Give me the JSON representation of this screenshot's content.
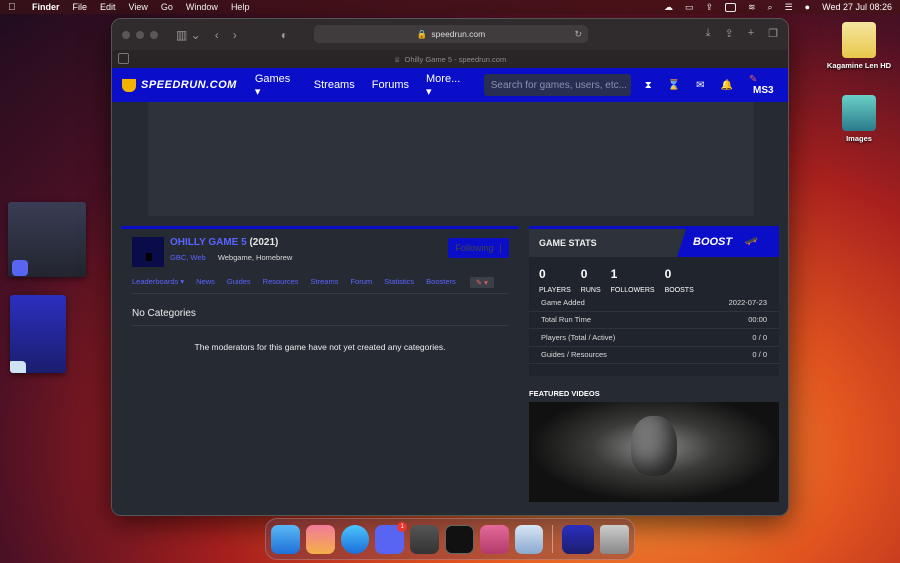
{
  "menubar": {
    "app_name": "Finder",
    "items": [
      "File",
      "Edit",
      "View",
      "Go",
      "Window",
      "Help"
    ],
    "datetime": "Wed 27 Jul  08:26"
  },
  "desktop": {
    "icons": [
      {
        "label": "Kagamine Len HD"
      },
      {
        "label": "Images"
      }
    ]
  },
  "browser": {
    "url": "speedrun.com",
    "tab_title": "Ohilly Game 5 - speedrun.com"
  },
  "site": {
    "logo": "SPEEDRUN.COM",
    "nav": {
      "games": "Games ▾",
      "streams": "Streams",
      "forums": "Forums",
      "more": "More... ▾"
    },
    "search_placeholder": "Search for games, users, etc...",
    "user": "MS3"
  },
  "game": {
    "name": "OHILLY GAME 5",
    "year": "(2021)",
    "platforms": "GBC, Web",
    "genres": "Webgame, Homebrew",
    "follow_label": "Following",
    "tabs": [
      "Leaderboards ▾",
      "News",
      "Guides",
      "Resources",
      "Streams",
      "Forum",
      "Statistics",
      "Boosters"
    ],
    "no_categories_title": "No Categories",
    "no_categories_msg": "The moderators for this game have not yet created any categories."
  },
  "stats": {
    "title": "GAME STATS",
    "boost_label": "BOOST",
    "counters": [
      {
        "value": "0",
        "label": "PLAYERS"
      },
      {
        "value": "0",
        "label": "RUNS"
      },
      {
        "value": "1",
        "label": "FOLLOWERS"
      },
      {
        "value": "0",
        "label": "BOOSTS"
      }
    ],
    "rows": [
      {
        "key": "Game Added",
        "value": "2022-07-23"
      },
      {
        "key": "Total Run Time",
        "value": "00:00"
      },
      {
        "key": "Players (Total / Active)",
        "value": "0 / 0"
      },
      {
        "key": "Guides / Resources",
        "value": "0 / 0"
      }
    ],
    "featured_label": "FEATURED VIDEOS"
  },
  "dock": {
    "discord_badge": "1"
  }
}
